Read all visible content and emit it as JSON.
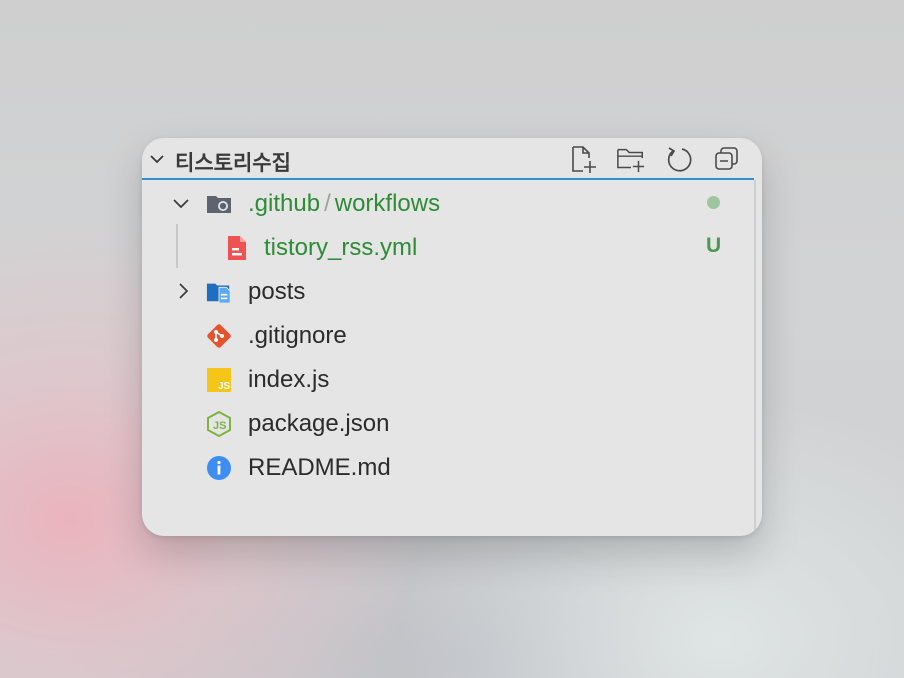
{
  "explorer": {
    "title": "티스토리수집",
    "actions": {
      "new_file": "new-file-icon",
      "new_folder": "new-folder-icon",
      "refresh": "refresh-icon",
      "collapse_all": "collapse-all-icon"
    },
    "accent_color": "#2f8fd6",
    "tree": [
      {
        "name_part1": ".github",
        "separator": "/",
        "name_part2": "workflows",
        "type": "folder",
        "expanded": true,
        "status": "modified-dot",
        "status_color": "#9cc69f"
      },
      {
        "name": "tistory_rss.yml",
        "type": "file",
        "icon": "yaml-file-icon",
        "status": "U",
        "status_color": "#4c9a4f"
      },
      {
        "name": "posts",
        "type": "folder",
        "expanded": false
      },
      {
        "name": ".gitignore",
        "type": "file",
        "icon": "git-icon"
      },
      {
        "name": "index.js",
        "type": "file",
        "icon": "javascript-icon"
      },
      {
        "name": "package.json",
        "type": "file",
        "icon": "nodejs-icon"
      },
      {
        "name": "README.md",
        "type": "file",
        "icon": "info-icon"
      }
    ]
  }
}
